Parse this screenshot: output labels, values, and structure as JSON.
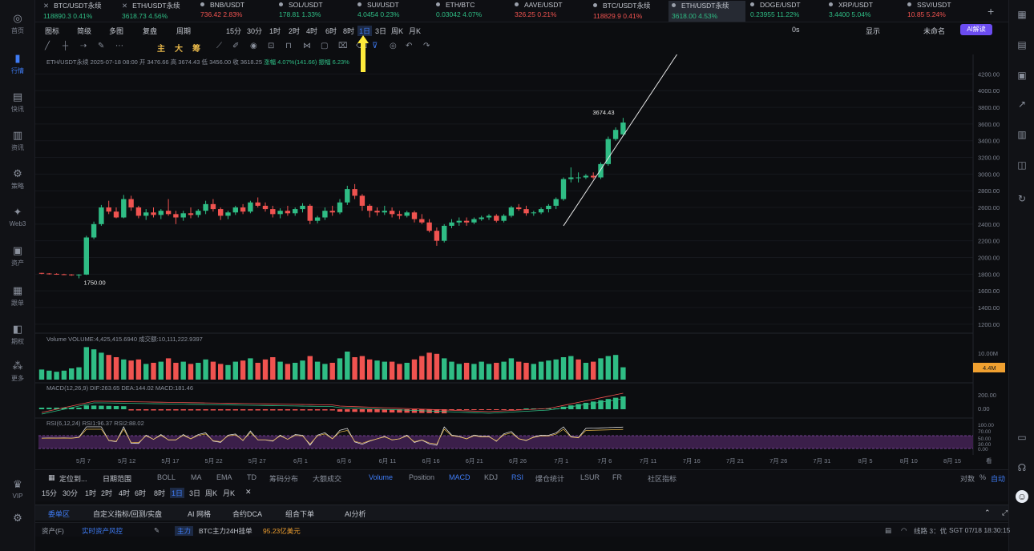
{
  "sidebar": {
    "items": [
      {
        "label": "首页",
        "icon": "home-icon",
        "glyph": "◎"
      },
      {
        "label": "行情",
        "icon": "chart-icon",
        "glyph": "▮"
      },
      {
        "label": "快讯",
        "icon": "news-icon",
        "glyph": "▤"
      },
      {
        "label": "资讯",
        "icon": "article-icon",
        "glyph": "▥"
      },
      {
        "label": "策略",
        "icon": "strategy-icon",
        "glyph": "⚙"
      },
      {
        "label": "Web3",
        "icon": "web3-icon",
        "glyph": "✦"
      },
      {
        "label": "资产",
        "icon": "wallet-icon",
        "glyph": "▣"
      },
      {
        "label": "跟单",
        "icon": "copytrade-icon",
        "glyph": "▦"
      },
      {
        "label": "期权",
        "icon": "options-icon",
        "glyph": "◧"
      },
      {
        "label": "更多",
        "icon": "more-icon",
        "glyph": "⁂"
      },
      {
        "label": "VIP",
        "icon": "vip-icon",
        "glyph": "♛"
      },
      {
        "label": "",
        "icon": "settings-icon",
        "glyph": "⚙"
      }
    ],
    "active_index": 1
  },
  "tickers": [
    {
      "symbol": "BTC/USDT永续",
      "price": "118890.3",
      "change": "0.41%",
      "dir": "up",
      "mark": "x"
    },
    {
      "symbol": "ETH/USDT永续",
      "price": "3618.73",
      "change": "4.56%",
      "dir": "up",
      "mark": "x"
    },
    {
      "symbol": "BNB/USDT",
      "price": "736.42",
      "change": "2.83%",
      "dir": "dn",
      "mark": "dot"
    },
    {
      "symbol": "SOL/USDT",
      "price": "178.81",
      "change": "1.33%",
      "dir": "up",
      "mark": "dot"
    },
    {
      "symbol": "SUI/USDT",
      "price": "4.0454",
      "change": "0.23%",
      "dir": "up",
      "mark": "dot"
    },
    {
      "symbol": "ETH/BTC",
      "price": "0.03042",
      "change": "4.07%",
      "dir": "up",
      "mark": "dot"
    },
    {
      "symbol": "AAVE/USDT",
      "price": "326.25",
      "change": "0.21%",
      "dir": "dn",
      "mark": "dot"
    },
    {
      "symbol": "BTC/USDT永续",
      "price": "118829.9",
      "change": "0.41%",
      "dir": "dn",
      "mark": "dot"
    },
    {
      "symbol": "ETH/USDT永续",
      "price": "3618.00",
      "change": "4.53%",
      "dir": "up",
      "mark": "dot",
      "active": true
    },
    {
      "symbol": "DOGE/USDT",
      "price": "0.23955",
      "change": "11.22%",
      "dir": "up",
      "mark": "dot"
    },
    {
      "symbol": "XRP/USDT",
      "price": "3.4400",
      "change": "5.04%",
      "dir": "up",
      "mark": "dot"
    },
    {
      "symbol": "SSV/USDT",
      "price": "10.85",
      "change": "5.24%",
      "dir": "dn",
      "mark": "dot"
    }
  ],
  "toolbar": {
    "items": [
      "图标",
      "简级",
      "多图",
      "复盘",
      "周期",
      "15分",
      "30分",
      "1时",
      "2时",
      "4时",
      "6时",
      "8时",
      "1日",
      "3日",
      "周K",
      "月K"
    ],
    "selected": "1日",
    "right": [
      "0s",
      "显示",
      "未命名"
    ],
    "ai_label": "AI解读"
  },
  "drawtools": [
    "主",
    "大",
    "筹"
  ],
  "chart": {
    "title_parts": [
      "ETH/USDT永续",
      "2025-07-18 08:00",
      "开 3476.66",
      "高 3674.43",
      "低 3456.00",
      "收 3618.25",
      "涨幅 4.07%(141.66)",
      "振幅 6.23%"
    ],
    "high_label": "3674.43",
    "low_label": "1750.00",
    "y_ticks": [
      "4200.00",
      "4000.00",
      "3800.00",
      "3600.00",
      "3400.00",
      "3200.00",
      "3000.00",
      "2800.00",
      "2600.00",
      "2400.00",
      "2200.00",
      "2000.00",
      "1800.00",
      "1600.00",
      "1400.00",
      "1200.00"
    ],
    "x_ticks": [
      "5月 7",
      "5月 12",
      "5月 17",
      "5月 22",
      "5月 27",
      "6月 1",
      "6月 6",
      "6月 11",
      "6月 16",
      "6月 21",
      "6月 26",
      "7月 1",
      "7月 6",
      "7月 11",
      "7月 16",
      "7月 21",
      "7月 26",
      "7月 31",
      "8月 5",
      "8月 10",
      "8月 15"
    ],
    "volume_title": "Volume  VOLUME:4,425,415.6940  成交额:10,111,222.9397",
    "volume_ticks": [
      "10.00M"
    ],
    "volume_tag": "4.4M",
    "macd_title": "MACD(12,26,9)  DIF:263.65  DEA:144.02  MACD:181.46",
    "macd_ticks": [
      "200.00",
      "0.00"
    ],
    "rsi_title": "RSI(6,12,24)  RSI1:96.37  RSI2:88.02",
    "rsi_ticks": [
      "100.00",
      "70.00",
      "50.00",
      "30.00",
      "0.00"
    ],
    "corner_label": "看"
  },
  "chart_data": {
    "type": "candlestick",
    "candles": [
      [
        1815,
        1815,
        1800,
        1808
      ],
      [
        1808,
        1812,
        1795,
        1804
      ],
      [
        1804,
        1810,
        1793,
        1799
      ],
      [
        1799,
        1805,
        1790,
        1796
      ],
      [
        1796,
        1800,
        1780,
        1790
      ],
      [
        1790,
        1800,
        1750,
        1795
      ],
      [
        1795,
        2260,
        1790,
        2240
      ],
      [
        2240,
        2430,
        2220,
        2400
      ],
      [
        2400,
        2630,
        2380,
        2600
      ],
      [
        2600,
        2680,
        2520,
        2550
      ],
      [
        2550,
        2600,
        2470,
        2480
      ],
      [
        2480,
        2750,
        2470,
        2700
      ],
      [
        2700,
        2740,
        2560,
        2600
      ],
      [
        2600,
        2620,
        2470,
        2500
      ],
      [
        2500,
        2580,
        2450,
        2540
      ],
      [
        2540,
        2600,
        2480,
        2510
      ],
      [
        2510,
        2580,
        2460,
        2560
      ],
      [
        2560,
        2700,
        2500,
        2520
      ],
      [
        2520,
        2560,
        2400,
        2480
      ],
      [
        2480,
        2560,
        2440,
        2530
      ],
      [
        2530,
        2600,
        2470,
        2510
      ],
      [
        2510,
        2580,
        2480,
        2560
      ],
      [
        2560,
        2680,
        2520,
        2640
      ],
      [
        2640,
        2700,
        2550,
        2580
      ],
      [
        2580,
        2600,
        2450,
        2500
      ],
      [
        2500,
        2560,
        2460,
        2540
      ],
      [
        2540,
        2620,
        2510,
        2600
      ],
      [
        2600,
        2640,
        2520,
        2550
      ],
      [
        2550,
        2680,
        2530,
        2660
      ],
      [
        2660,
        2720,
        2600,
        2620
      ],
      [
        2620,
        2660,
        2550,
        2580
      ],
      [
        2580,
        2620,
        2480,
        2520
      ],
      [
        2520,
        2590,
        2470,
        2560
      ],
      [
        2560,
        2620,
        2500,
        2530
      ],
      [
        2530,
        2600,
        2500,
        2580
      ],
      [
        2580,
        2650,
        2540,
        2620
      ],
      [
        2620,
        2640,
        2400,
        2440
      ],
      [
        2440,
        2500,
        2410,
        2480
      ],
      [
        2480,
        2600,
        2450,
        2560
      ],
      [
        2560,
        2620,
        2500,
        2540
      ],
      [
        2540,
        2700,
        2520,
        2660
      ],
      [
        2660,
        2860,
        2630,
        2820
      ],
      [
        2820,
        2880,
        2700,
        2740
      ],
      [
        2740,
        2760,
        2560,
        2620
      ],
      [
        2620,
        2640,
        2480,
        2560
      ],
      [
        2560,
        2600,
        2500,
        2540
      ],
      [
        2540,
        2620,
        2510,
        2560
      ],
      [
        2560,
        2600,
        2480,
        2520
      ],
      [
        2520,
        2560,
        2460,
        2500
      ],
      [
        2500,
        2560,
        2480,
        2540
      ],
      [
        2540,
        2560,
        2420,
        2460
      ],
      [
        2460,
        2520,
        2400,
        2420
      ],
      [
        2420,
        2460,
        2300,
        2320
      ],
      [
        2320,
        2360,
        2140,
        2200
      ],
      [
        2200,
        2400,
        2180,
        2380
      ],
      [
        2380,
        2460,
        2350,
        2420
      ],
      [
        2420,
        2480,
        2380,
        2440
      ],
      [
        2440,
        2480,
        2380,
        2420
      ],
      [
        2420,
        2480,
        2400,
        2460
      ],
      [
        2460,
        2500,
        2440,
        2480
      ],
      [
        2480,
        2520,
        2450,
        2500
      ],
      [
        2500,
        2520,
        2420,
        2440
      ],
      [
        2440,
        2520,
        2420,
        2500
      ],
      [
        2500,
        2620,
        2480,
        2600
      ],
      [
        2600,
        2640,
        2560,
        2580
      ],
      [
        2580,
        2620,
        2500,
        2530
      ],
      [
        2530,
        2560,
        2500,
        2540
      ],
      [
        2540,
        2600,
        2520,
        2580
      ],
      [
        2580,
        2640,
        2540,
        2620
      ],
      [
        2620,
        2720,
        2580,
        2700
      ],
      [
        2700,
        2960,
        2680,
        2940
      ],
      [
        2940,
        3080,
        2900,
        2960
      ],
      [
        2960,
        3020,
        2900,
        2960
      ],
      [
        2960,
        3000,
        2940,
        2980
      ],
      [
        2980,
        3020,
        2940,
        2960
      ],
      [
        2960,
        3140,
        2940,
        3120
      ],
      [
        3120,
        3450,
        3100,
        3420
      ],
      [
        3420,
        3560,
        3400,
        3530
      ],
      [
        3476,
        3674,
        3456,
        3618
      ]
    ],
    "volumes": [
      [
        0.45,
        1
      ],
      [
        0.4,
        1
      ],
      [
        0.35,
        1
      ],
      [
        0.4,
        1
      ],
      [
        0.5,
        1
      ],
      [
        0.55,
        1
      ],
      [
        1.45,
        1
      ],
      [
        1.35,
        1
      ],
      [
        1.2,
        1
      ],
      [
        1.1,
        0
      ],
      [
        1.0,
        0
      ],
      [
        0.9,
        1
      ],
      [
        0.85,
        0
      ],
      [
        0.9,
        0
      ],
      [
        0.7,
        1
      ],
      [
        0.75,
        0
      ],
      [
        0.8,
        1
      ],
      [
        0.95,
        0
      ],
      [
        0.75,
        0
      ],
      [
        0.8,
        1
      ],
      [
        0.7,
        0
      ],
      [
        0.75,
        1
      ],
      [
        0.9,
        1
      ],
      [
        0.8,
        0
      ],
      [
        0.7,
        0
      ],
      [
        0.65,
        1
      ],
      [
        0.8,
        1
      ],
      [
        0.85,
        0
      ],
      [
        0.95,
        1
      ],
      [
        0.75,
        0
      ],
      [
        0.9,
        0
      ],
      [
        1.0,
        0
      ],
      [
        0.8,
        1
      ],
      [
        0.7,
        0
      ],
      [
        0.75,
        1
      ],
      [
        0.85,
        1
      ],
      [
        1.05,
        0
      ],
      [
        0.8,
        1
      ],
      [
        0.7,
        1
      ],
      [
        0.75,
        0
      ],
      [
        0.95,
        1
      ],
      [
        1.25,
        1
      ],
      [
        1.0,
        0
      ],
      [
        1.05,
        0
      ],
      [
        0.9,
        0
      ],
      [
        0.85,
        1
      ],
      [
        0.8,
        1
      ],
      [
        0.8,
        0
      ],
      [
        0.7,
        0
      ],
      [
        0.75,
        1
      ],
      [
        0.9,
        0
      ],
      [
        1.05,
        0
      ],
      [
        1.2,
        0
      ],
      [
        1.15,
        0
      ],
      [
        0.95,
        1
      ],
      [
        0.8,
        1
      ],
      [
        0.7,
        1
      ],
      [
        0.75,
        0
      ],
      [
        0.7,
        1
      ],
      [
        0.8,
        1
      ],
      [
        0.7,
        1
      ],
      [
        0.75,
        0
      ],
      [
        0.8,
        1
      ],
      [
        0.95,
        1
      ],
      [
        0.8,
        0
      ],
      [
        0.75,
        0
      ],
      [
        0.7,
        1
      ],
      [
        0.8,
        1
      ],
      [
        0.85,
        1
      ],
      [
        0.9,
        1
      ],
      [
        1.0,
        1
      ],
      [
        1.05,
        1
      ],
      [
        0.9,
        0
      ],
      [
        0.75,
        1
      ],
      [
        0.8,
        0
      ],
      [
        0.95,
        1
      ],
      [
        1.05,
        1
      ],
      [
        1.1,
        1
      ],
      [
        0.55,
        1
      ]
    ],
    "trendline": [
      [
        70,
        2380
      ],
      [
        86,
        4540
      ]
    ],
    "y_range": [
      1150,
      4300
    ]
  },
  "bottom_toolbar": {
    "row1_left": [
      "定位到...",
      "日期范围"
    ],
    "indicators": [
      "BOLL",
      "MA",
      "EMA",
      "TD",
      "筹码分布",
      "大额成交",
      "Volume",
      "Position",
      "MACD",
      "KDJ",
      "RSI",
      "爆仓统计",
      "LSUR",
      "FR",
      "社区指标"
    ],
    "active_indicators": [
      "Volume",
      "MACD",
      "RSI"
    ],
    "right": [
      "对数",
      "%",
      "自动"
    ],
    "row2": [
      "15分",
      "30分",
      "1时",
      "2时",
      "4时",
      "6时",
      "8时",
      "1日",
      "3日",
      "周K",
      "月K"
    ],
    "row2_selected": "1日"
  },
  "tabs": [
    "委单区",
    "自定义指标/回测/实盘",
    "AI 网格",
    "合约DCA",
    "组合下单",
    "AI分析"
  ],
  "status": {
    "asset_label": "资产(F)",
    "risk_label": "实时资产风控",
    "badge": "主力",
    "btc_text": "BTC主力24H挂单",
    "btc_value": "95.23亿美元",
    "line_label": "线路 3：优",
    "time": "SGT 07/18 18:30:15"
  },
  "colors": {
    "up": "#2fbd85",
    "down": "#f05350",
    "accent": "#3f7cf5",
    "arrow": "#ffeb3b"
  }
}
